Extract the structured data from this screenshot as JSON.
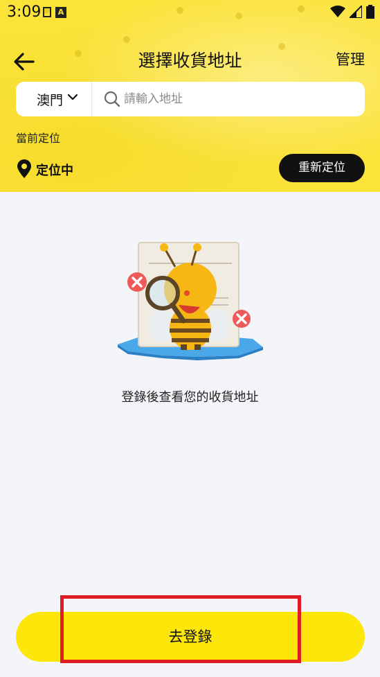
{
  "status_bar": {
    "time": "3:09",
    "icons": [
      "notification-icon",
      "a-icon",
      "wifi-icon",
      "signal-icon",
      "battery-icon"
    ]
  },
  "nav": {
    "back_icon": "arrow-left-icon",
    "title": "選擇收貨地址",
    "manage_label": "管理"
  },
  "search": {
    "city": "澳門",
    "placeholder": "請輸入地址"
  },
  "current_location": {
    "label": "當前定位",
    "status": "定位中",
    "relocate_label": "重新定位"
  },
  "empty_state": {
    "message": "登錄後查看您的收貨地址"
  },
  "footer": {
    "login_label": "去登錄"
  },
  "colors": {
    "accent_yellow": "#fde60a",
    "header_yellow": "#fbe33a",
    "relocate_bg": "#111111",
    "highlight_red": "#e01b24"
  }
}
